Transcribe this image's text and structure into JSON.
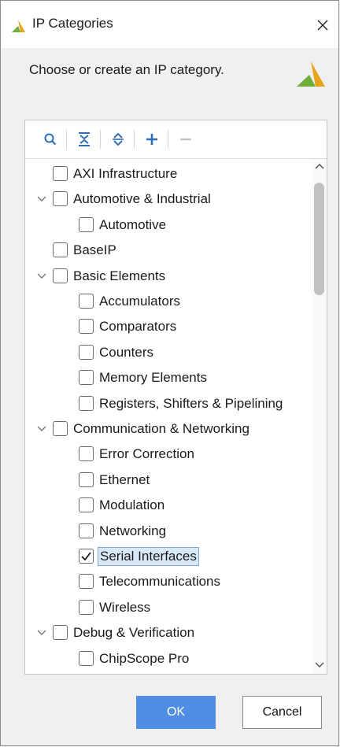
{
  "window": {
    "title": "IP Categories",
    "instruction": "Choose or create an IP category."
  },
  "toolbar": {
    "items": [
      "search-icon",
      "collapse-all-icon",
      "expand-all-icon",
      "plus-icon",
      "minus-icon"
    ]
  },
  "tree": {
    "items": [
      {
        "label": "AXI Infrastructure",
        "level": 0,
        "expandable": false,
        "checked": false
      },
      {
        "label": "Automotive & Industrial",
        "level": 0,
        "expandable": true,
        "checked": false
      },
      {
        "label": "Automotive",
        "level": 1,
        "expandable": false,
        "checked": false
      },
      {
        "label": "BaseIP",
        "level": 0,
        "expandable": false,
        "checked": false
      },
      {
        "label": "Basic Elements",
        "level": 0,
        "expandable": true,
        "checked": false
      },
      {
        "label": "Accumulators",
        "level": 1,
        "expandable": false,
        "checked": false
      },
      {
        "label": "Comparators",
        "level": 1,
        "expandable": false,
        "checked": false
      },
      {
        "label": "Counters",
        "level": 1,
        "expandable": false,
        "checked": false
      },
      {
        "label": "Memory Elements",
        "level": 1,
        "expandable": false,
        "checked": false
      },
      {
        "label": "Registers, Shifters & Pipelining",
        "level": 1,
        "expandable": false,
        "checked": false
      },
      {
        "label": "Communication & Networking",
        "level": 0,
        "expandable": true,
        "checked": false
      },
      {
        "label": "Error Correction",
        "level": 1,
        "expandable": false,
        "checked": false
      },
      {
        "label": "Ethernet",
        "level": 1,
        "expandable": false,
        "checked": false
      },
      {
        "label": "Modulation",
        "level": 1,
        "expandable": false,
        "checked": false
      },
      {
        "label": "Networking",
        "level": 1,
        "expandable": false,
        "checked": false
      },
      {
        "label": "Serial Interfaces",
        "level": 1,
        "expandable": false,
        "checked": true,
        "selected": true
      },
      {
        "label": "Telecommunications",
        "level": 1,
        "expandable": false,
        "checked": false
      },
      {
        "label": "Wireless",
        "level": 1,
        "expandable": false,
        "checked": false
      },
      {
        "label": "Debug & Verification",
        "level": 0,
        "expandable": true,
        "checked": false
      },
      {
        "label": "ChipScope Pro",
        "level": 1,
        "expandable": false,
        "checked": false
      }
    ]
  },
  "buttons": {
    "ok_label": "OK",
    "cancel_label": "Cancel"
  },
  "colors": {
    "accent": "#4f8ee3",
    "logo_orange": "#e8a317",
    "logo_green": "#6fae3a"
  }
}
